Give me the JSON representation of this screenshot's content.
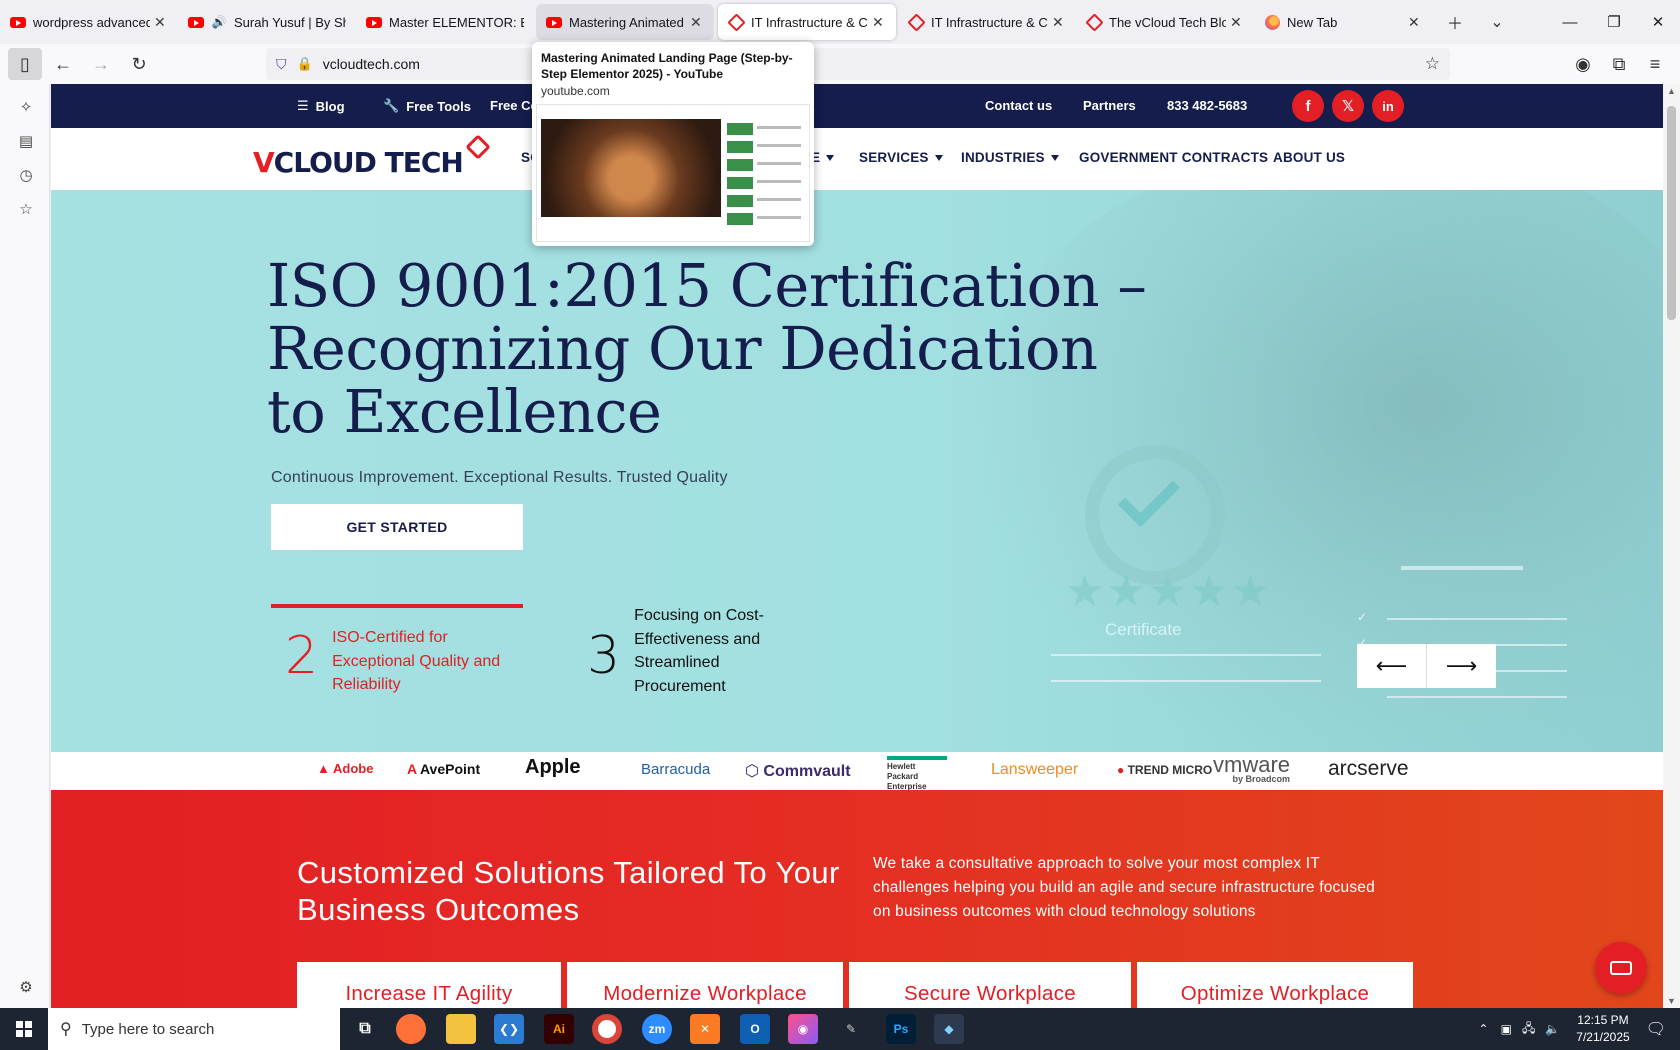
{
  "browser": {
    "tabs": [
      {
        "title": "wordpress advanced ar",
        "icon": "youtube-icon"
      },
      {
        "title": "Surah Yusuf | By Sh",
        "icon": "youtube-icon"
      },
      {
        "title": "Master ELEMENTOR: Bi",
        "icon": "youtube-icon"
      },
      {
        "title": "Mastering Animated L",
        "icon": "youtube-icon"
      },
      {
        "title": "IT Infrastructure & Cyb",
        "icon": "vcloud-icon"
      },
      {
        "title": "IT Infrastructure & Cyb",
        "icon": "vcloud-icon"
      },
      {
        "title": "The vCloud Tech Blogs",
        "icon": "vcloud-icon"
      },
      {
        "title": "New Tab",
        "icon": "firefox-icon"
      }
    ],
    "url": "vcloudtech.com",
    "preview": {
      "title": "Mastering Animated Landing Page (Step-by-Step Elementor 2025) - YouTube",
      "domain": "youtube.com"
    }
  },
  "site": {
    "topbar": {
      "blog": "Blog",
      "free_tools": "Free Tools",
      "free_co": "Free Co",
      "contact": "Contact us",
      "partners": "Partners",
      "phone": "833 482-5683",
      "social": {
        "facebook": "f",
        "x": "𝕏",
        "linkedin": "in"
      }
    },
    "logo": {
      "v": "V",
      "rest": "CLOUD TECH"
    },
    "menu": {
      "so": "SO",
      "e": "E",
      "services": "SERVICES",
      "industries": "INDUSTRIES",
      "gov": "GOVERNMENT CONTRACTS",
      "about": "ABOUT US"
    },
    "hero": {
      "title": "ISO 9001:2015 Certification – Recognizing Our Dedication to Excellence",
      "subtitle": "Continuous Improvement. Exceptional Results. Trusted Quality",
      "cta": "GET STARTED",
      "stat1_num": "2",
      "stat1_text": "ISO-Certified for Exceptional Quality and Reliability",
      "stat2_num": "3",
      "stat2_text": "Focusing on Cost-Effectiveness and Streamlined Procurement",
      "certificate": "Certificate",
      "prev_arrow": "⟵",
      "next_arrow": "⟶"
    },
    "partners": {
      "adobe": "Adobe",
      "avepoint": "AvePoint",
      "apple": "Apple",
      "barracuda": "Barracuda",
      "commvault": "Commvault",
      "hpe": "Hewlett Packard Enterprise",
      "lansweeper": "Lansweeper",
      "trend": "TREND MICRO",
      "vmware": "vmware",
      "broadcom": "by Broadcom",
      "arcserve": "arcserve"
    },
    "solutions": {
      "heading": "Customized Solutions Tailored To Your Business Outcomes",
      "body": "We take a consultative approach to solve your most complex IT challenges helping you build an agile and secure infrastructure focused on business outcomes with cloud technology solutions",
      "cards": [
        "Increase IT Agility",
        "Modernize Workplace",
        "Secure Workplace",
        "Optimize Workplace"
      ]
    }
  },
  "taskbar": {
    "search_placeholder": "Type here to search",
    "time": "12:15 PM",
    "date": "7/21/2025",
    "apps": [
      "Ai",
      "zm",
      "Ps"
    ]
  },
  "colors": {
    "navy": "#141d4b",
    "brand_red": "#e31e24",
    "hero_bg": "#a6e1e2"
  }
}
